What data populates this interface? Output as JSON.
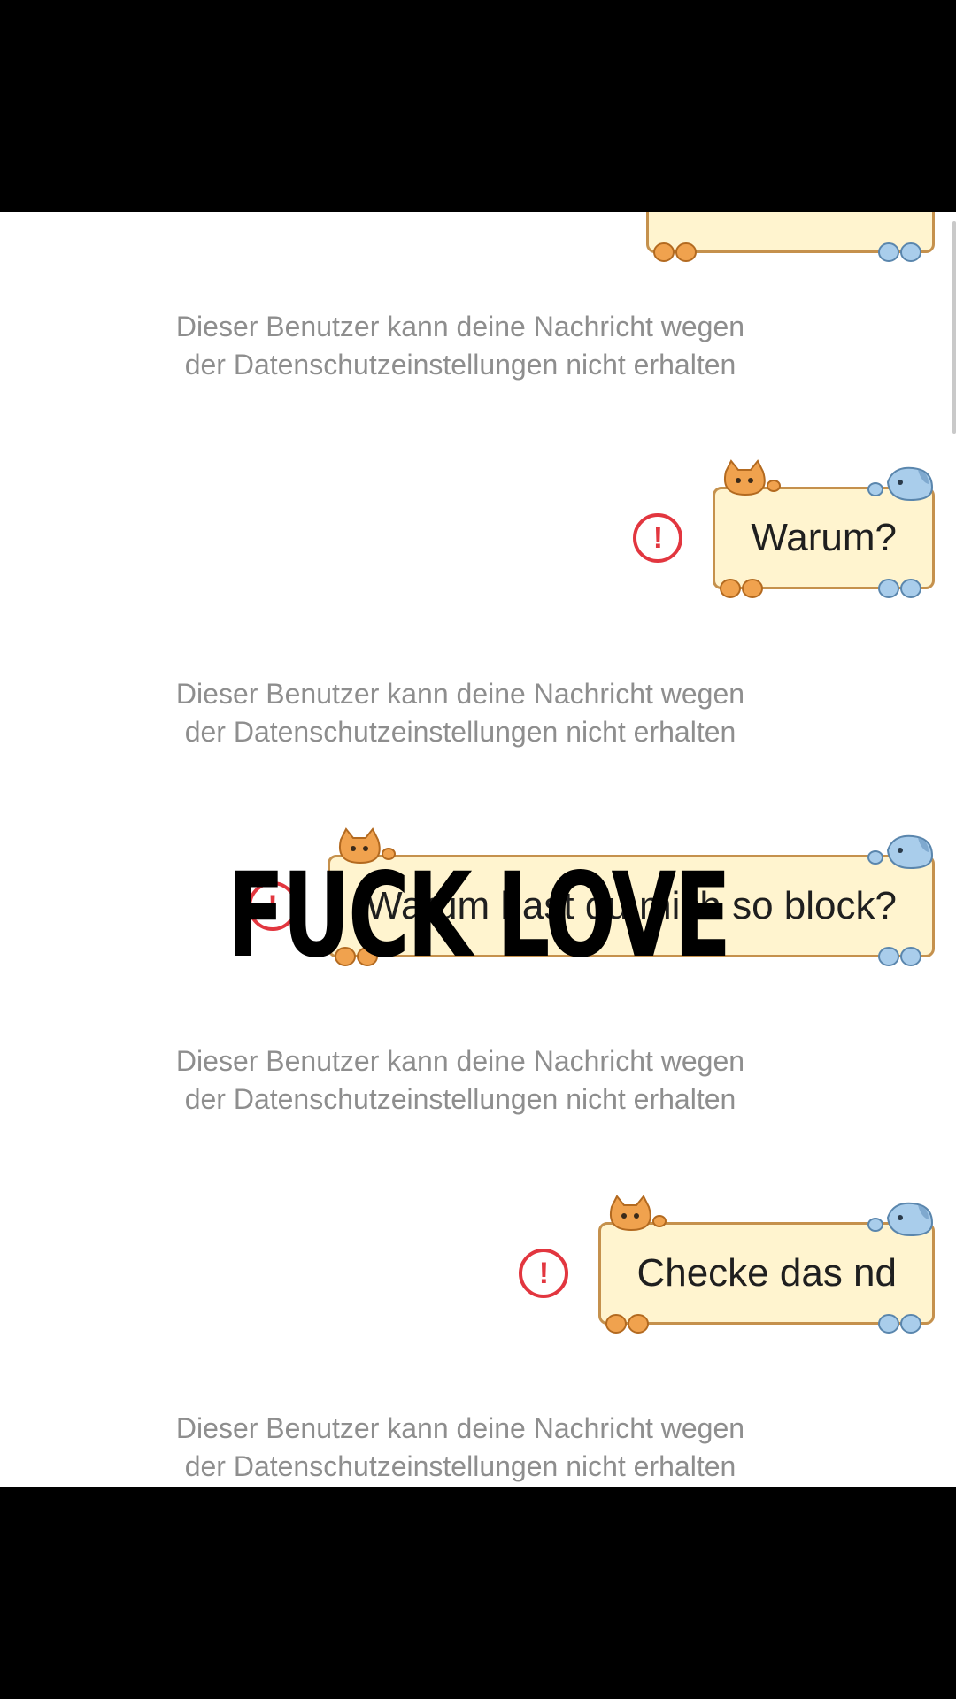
{
  "system_notice": "Dieser Benutzer kann deine Nachricht wegen der Datenschutzeinstellungen nicht erhalten",
  "messages": [
    {
      "text": "Warum?"
    },
    {
      "text": "Warum hast du mich so block?"
    },
    {
      "text": "Checke das nd"
    }
  ],
  "overlay_caption": "FUCK LOVE",
  "error_glyph": "!",
  "colors": {
    "bubble_bg": "#fff4cf",
    "bubble_border": "#c5914d",
    "error_red": "#e2363f",
    "notice_gray": "#8e8e8e"
  }
}
